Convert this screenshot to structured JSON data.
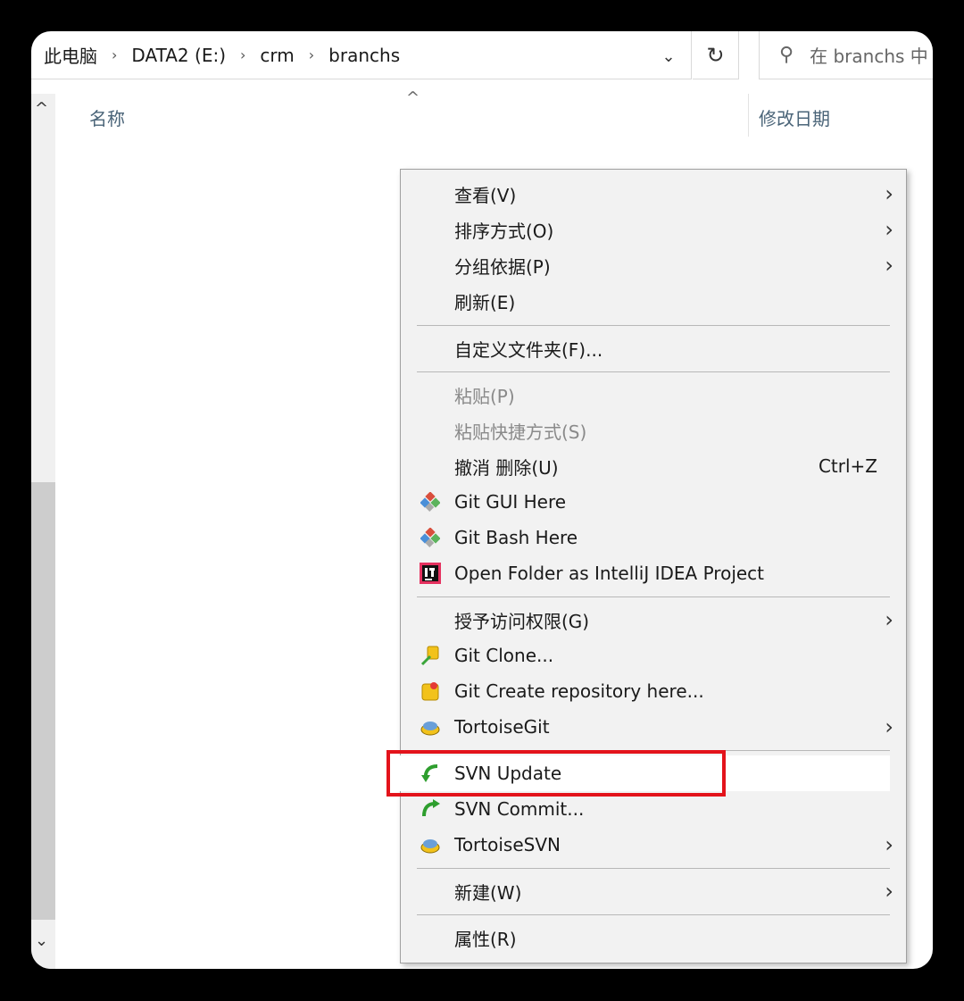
{
  "breadcrumb": [
    "此电脑",
    "DATA2 (E:)",
    "crm",
    "branchs"
  ],
  "breadcrumb_sep": "›",
  "address_dropdown": "⌄",
  "refresh": "↻",
  "search": {
    "placeholder": "在 branchs 中",
    "shown_text": "在 branchs 中"
  },
  "columns": {
    "name": "名称",
    "date": "修改日期"
  },
  "sort_arrow": "^",
  "scroll": {
    "up": "^",
    "down": "⌄"
  },
  "menu": {
    "items": [
      {
        "label": "查看(V)",
        "submenu": true
      },
      {
        "label": "排序方式(O)",
        "submenu": true
      },
      {
        "label": "分组依据(P)",
        "submenu": true
      },
      {
        "label": "刷新(E)"
      },
      {
        "label": "自定义文件夹(F)..."
      },
      {
        "label": "粘贴(P)",
        "disabled": true
      },
      {
        "label": "粘贴快捷方式(S)",
        "disabled": true
      },
      {
        "label": "撤消 删除(U)",
        "shortcut": "Ctrl+Z"
      },
      {
        "label": "Git GUI Here",
        "icon": "git-icon"
      },
      {
        "label": "Git Bash Here",
        "icon": "git-icon"
      },
      {
        "label": "Open Folder as IntelliJ IDEA Project",
        "icon": "intellij-icon"
      },
      {
        "label": "授予访问权限(G)",
        "submenu": true
      },
      {
        "label": "Git Clone...",
        "icon": "git-clone-icon"
      },
      {
        "label": "Git Create repository here...",
        "icon": "git-create-repo-icon"
      },
      {
        "label": "TortoiseGit",
        "icon": "tortoisegit-icon",
        "submenu": true
      },
      {
        "label": "SVN Update",
        "icon": "svn-update-icon",
        "highlighted": true
      },
      {
        "label": "SVN Commit...",
        "icon": "svn-commit-icon"
      },
      {
        "label": "TortoiseSVN",
        "icon": "tortoisesvn-icon",
        "submenu": true
      },
      {
        "label": "新建(W)",
        "submenu": true
      },
      {
        "label": "属性(R)"
      }
    ],
    "chevron": "›"
  },
  "colors": {
    "highlight_box": "#e3131b",
    "menu_bg": "#f2f2f2"
  }
}
